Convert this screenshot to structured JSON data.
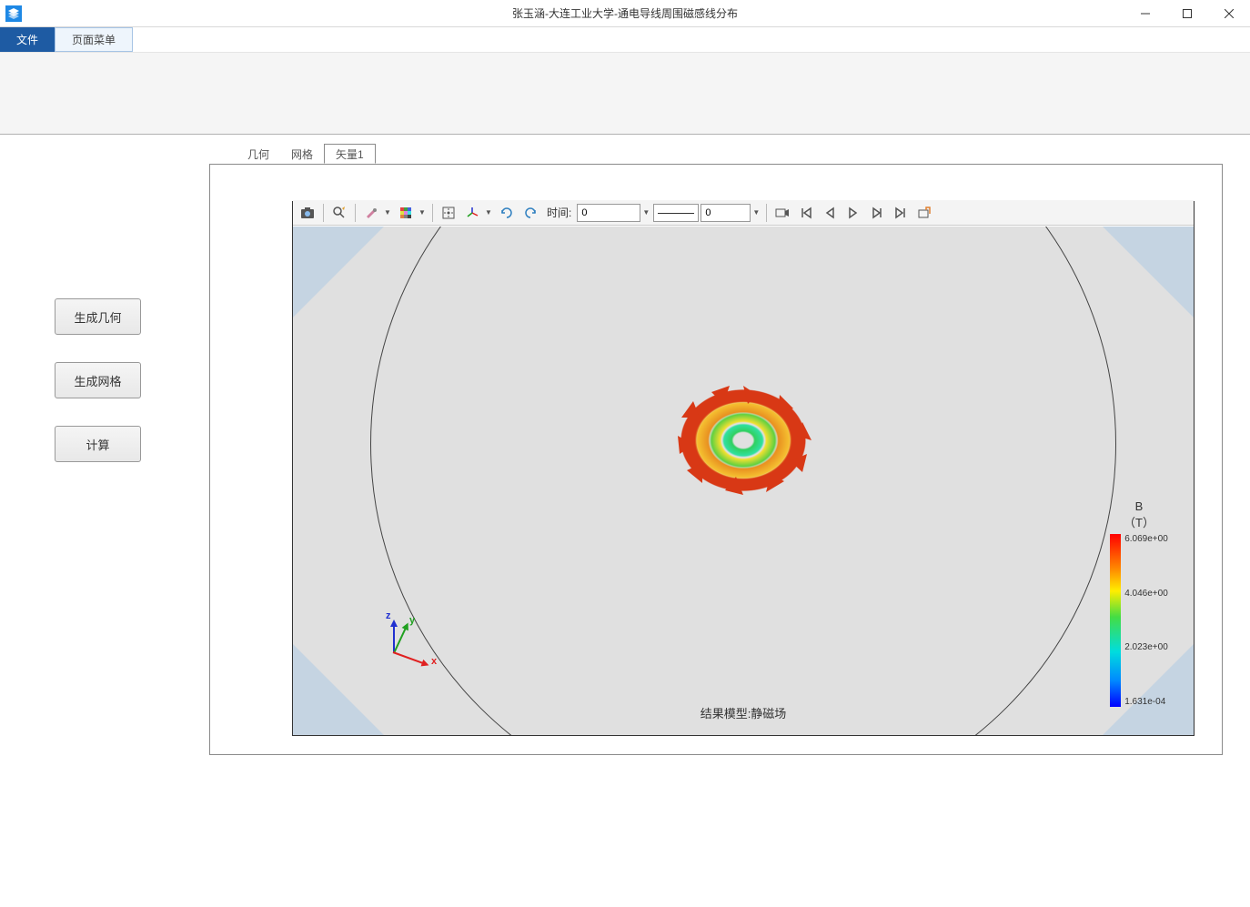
{
  "window": {
    "title": "张玉涵-大连工业大学-通电导线周围磁感线分布"
  },
  "menubar": {
    "file": "文件",
    "page_menu": "页面菜单"
  },
  "left_panel": {
    "btn_geometry": "生成几何",
    "btn_mesh": "生成网格",
    "btn_compute": "计算"
  },
  "tabs": {
    "geometry": "几何",
    "mesh": "网格",
    "vector1": "矢量1"
  },
  "view_toolbar": {
    "time_label": "时间:",
    "time_value_start": "0",
    "time_value_end": "0"
  },
  "axis": {
    "x": "x",
    "y": "y",
    "z": "z"
  },
  "result_label": "结果模型:静磁场",
  "legend": {
    "title_line1": "B",
    "title_line2": "（T）",
    "ticks": {
      "v0": "6.069e+00",
      "v1": "4.046e+00",
      "v2": "2.023e+00",
      "v3": "1.631e-04"
    }
  }
}
